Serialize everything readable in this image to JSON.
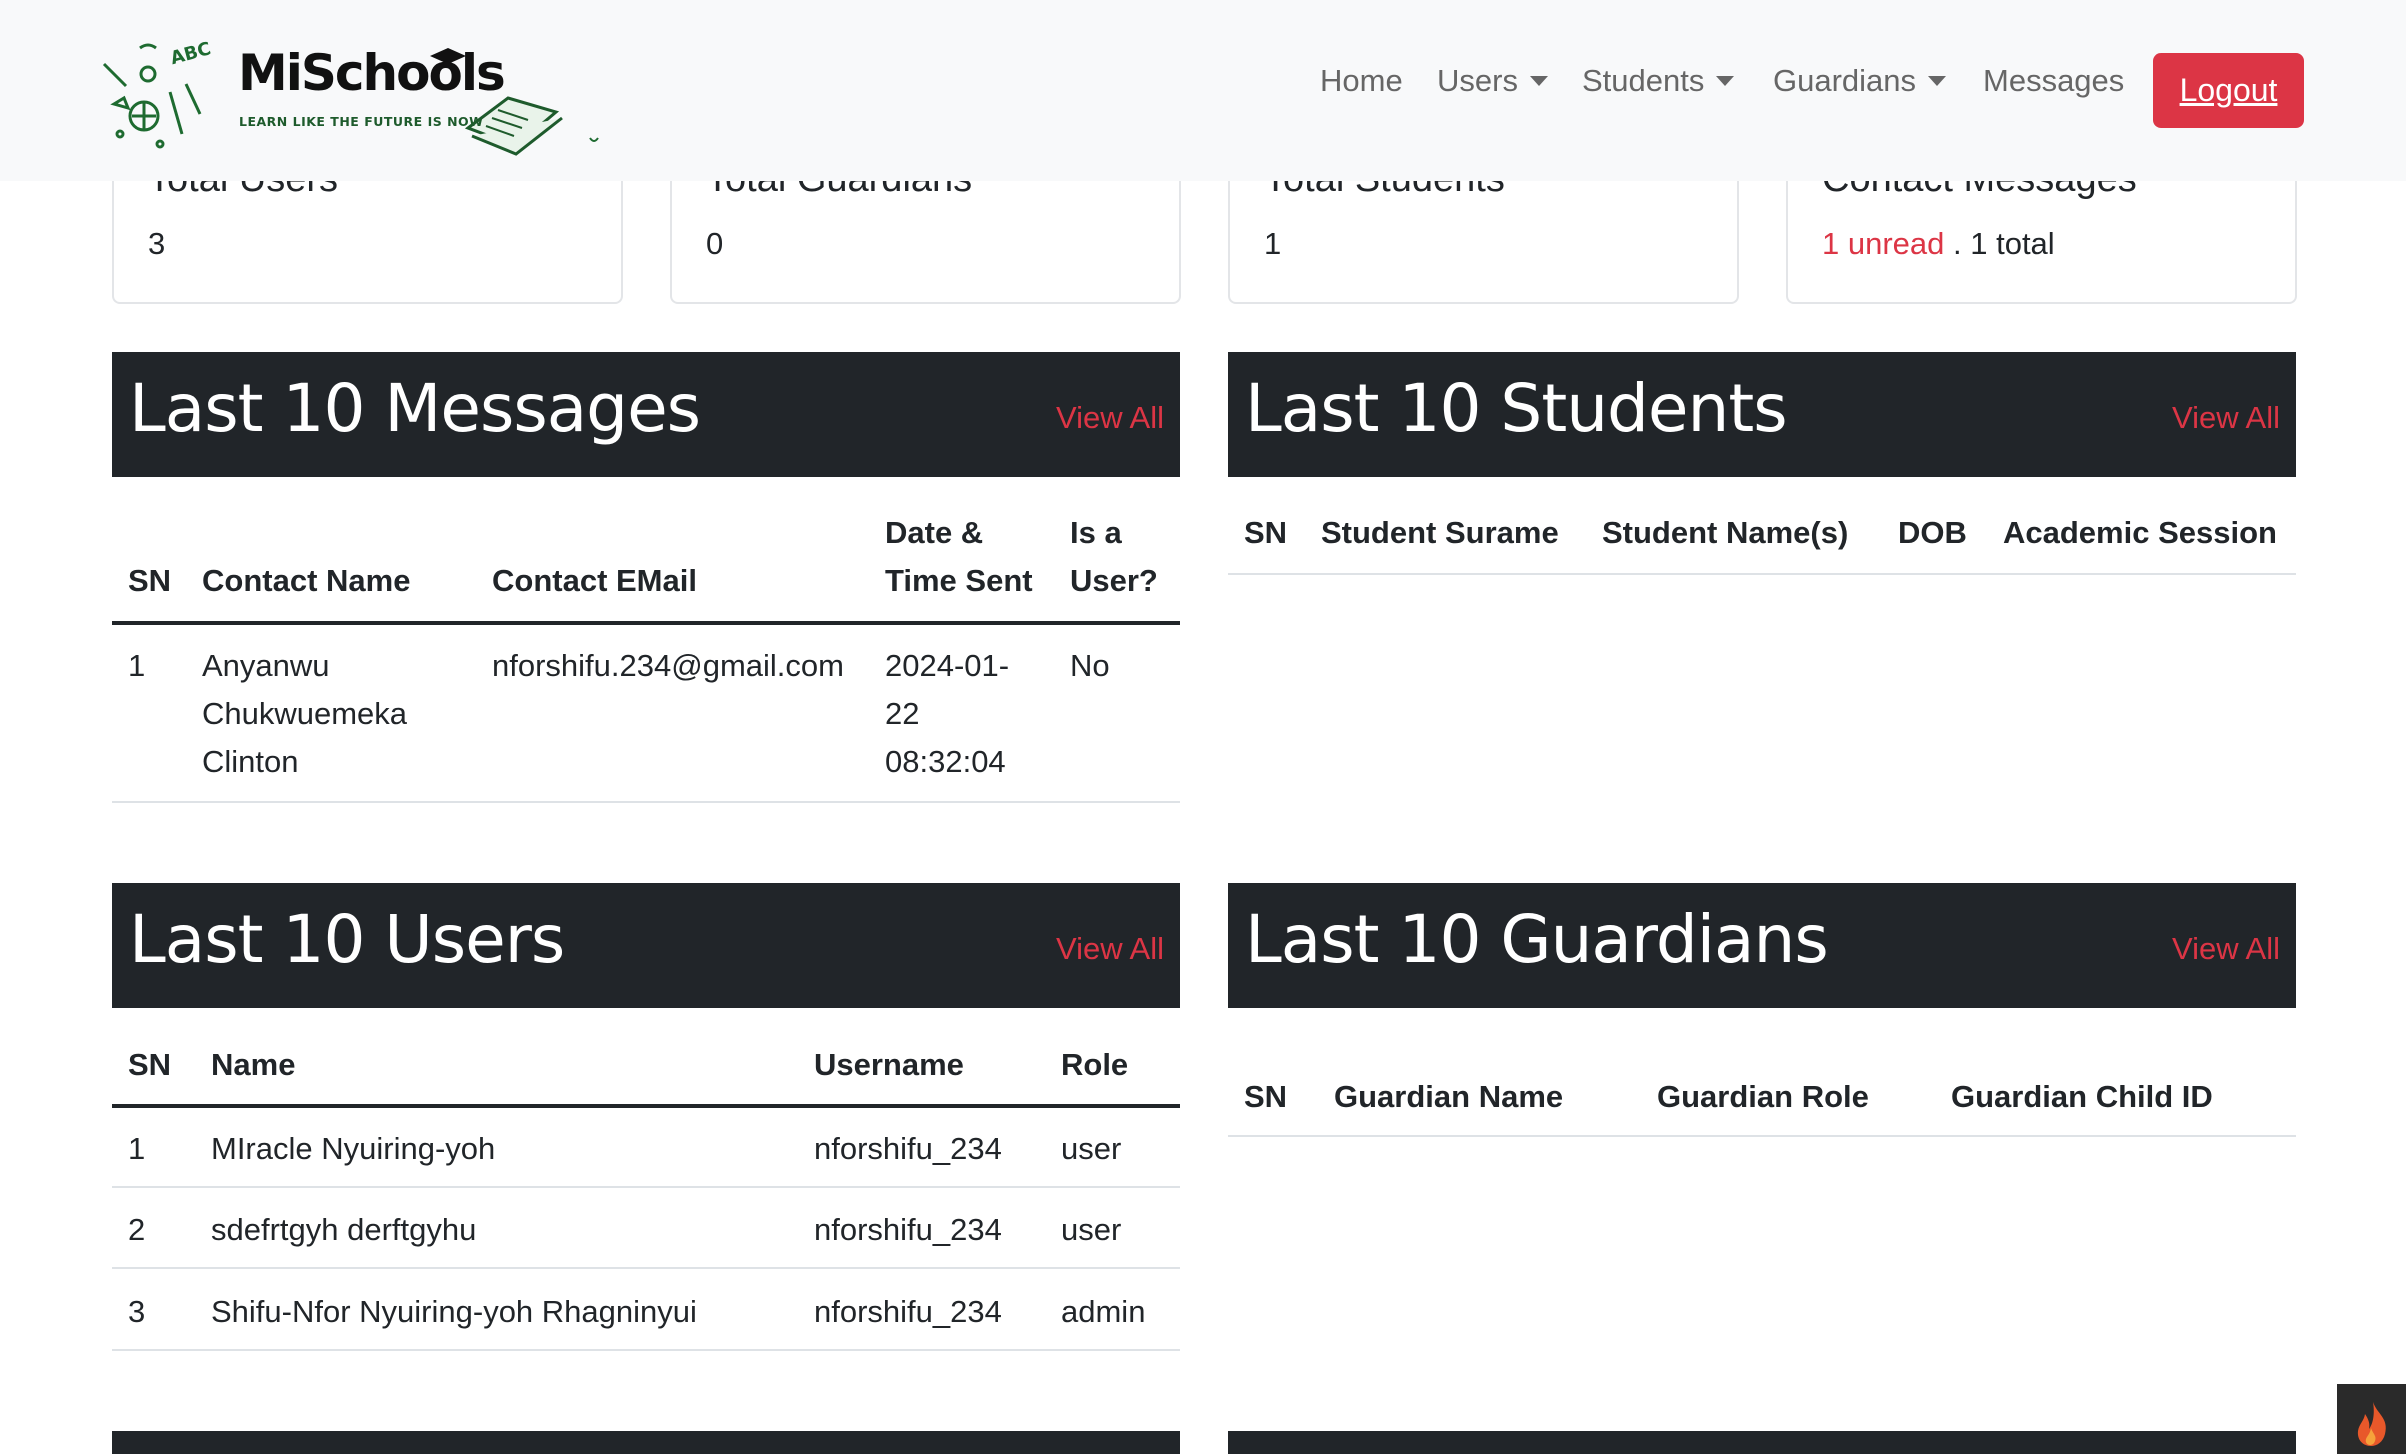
{
  "navbar": {
    "brand": {
      "name": "MiSchools",
      "tagline": "LEARN LIKE THE FUTURE IS NOW"
    },
    "links": {
      "home": "Home",
      "users": "Users",
      "students": "Students",
      "guardians": "Guardians",
      "messages": "Messages"
    },
    "logout": "Logout"
  },
  "stats": {
    "users": {
      "title": "Total Users",
      "value": "3"
    },
    "guardians": {
      "title": "Total Guardians",
      "value": "0"
    },
    "students": {
      "title": "Total Students",
      "value": "1"
    },
    "messages": {
      "title": "Contact Messages",
      "unread": "1 unread",
      "total": ". 1 total"
    }
  },
  "sections": {
    "messages": {
      "title": "Last 10 Messages",
      "view_all": "View All",
      "headers": {
        "sn": "SN",
        "name": "Contact Name",
        "email": "Contact EMail",
        "date_1": "Date &",
        "date_2": "Time Sent",
        "user_1": "Is a",
        "user_2": "User?"
      },
      "rows": [
        {
          "sn": "1",
          "name_1": "Anyanwu",
          "name_2": "Chukwuemeka",
          "name_3": "Clinton",
          "email": "nforshifu.234@gmail.com",
          "date_1": "2024-01-",
          "date_2": "22",
          "date_3": "08:32:04",
          "is_user": "No"
        }
      ]
    },
    "students": {
      "title": "Last 10 Students",
      "view_all": "View All",
      "headers": {
        "sn": "SN",
        "surname": "Student Surame",
        "names": "Student Name(s)",
        "dob": "DOB",
        "session": "Academic Session"
      }
    },
    "users": {
      "title": "Last 10 Users",
      "view_all": "View All",
      "headers": {
        "sn": "SN",
        "name": "Name",
        "username": "Username",
        "role": "Role"
      },
      "rows": [
        {
          "sn": "1",
          "name": "MIracle Nyuiring-yoh",
          "username": "nforshifu_234",
          "role": "user"
        },
        {
          "sn": "2",
          "name": "sdefrtgyh derftgyhu",
          "username": "nforshifu_234",
          "role": "user"
        },
        {
          "sn": "3",
          "name": "Shifu-Nfor Nyuiring-yoh Rhagninyui",
          "username": "nforshifu_234",
          "role": "admin"
        }
      ]
    },
    "guardians": {
      "title": "Last 10 Guardians",
      "view_all": "View All",
      "headers": {
        "sn": "SN",
        "name": "Guardian Name",
        "role": "Guardian Role",
        "child": "Guardian Child ID"
      }
    }
  },
  "colors": {
    "accent": "#dc3545",
    "dark": "#212529",
    "navbar_bg": "#f8f9fa",
    "brand_green": "#1e5b2c"
  }
}
